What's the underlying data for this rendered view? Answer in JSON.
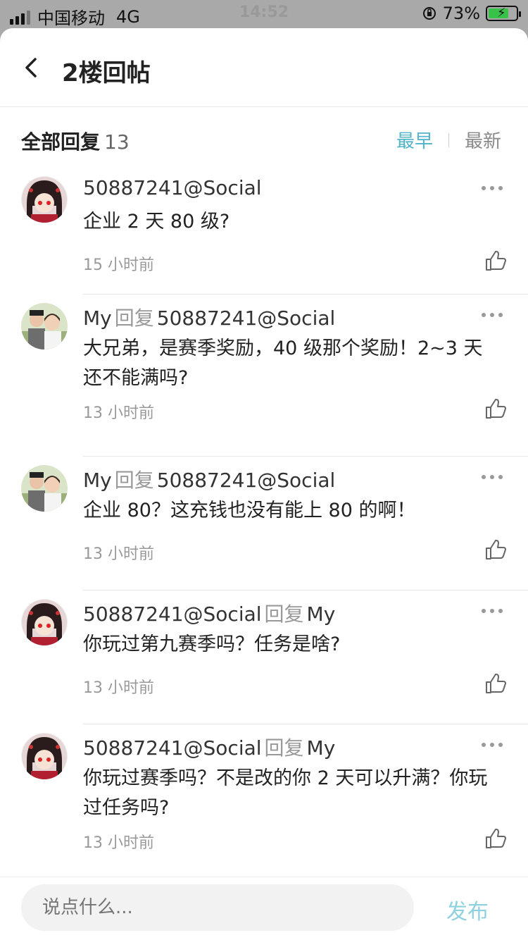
{
  "status_bar": {
    "carrier": "中国移动",
    "network": "4G",
    "time": "14:52",
    "battery": "73%",
    "battery_level": 0.73
  },
  "nav": {
    "title": "2楼回帖"
  },
  "subheader": {
    "label": "全部回复",
    "count": "13",
    "sort_earliest": "最早",
    "sort_latest": "最新"
  },
  "replies": [
    {
      "user": "50887241@Social",
      "verb": "",
      "target": "",
      "content": "企业 2 天 80 级?",
      "time": "15 小时前",
      "avatar": "anime-girl-avatar"
    },
    {
      "user": "My",
      "verb": "回复",
      "target": "50887241@Social",
      "content": "大兄弟，是赛季奖励，40 级那个奖励！2~3 天还不能满吗?",
      "time": "13 小时前",
      "avatar": "couple-photo-avatar"
    },
    {
      "user": "My",
      "verb": "回复",
      "target": "50887241@Social",
      "content": "企业 80？这充钱也没有能上 80 的啊！",
      "time": "13 小时前",
      "avatar": "couple-photo-avatar"
    },
    {
      "user": "50887241@Social",
      "verb": "回复",
      "target": "My",
      "content": "你玩过第九赛季吗？任务是啥?",
      "time": "13 小时前",
      "avatar": "anime-girl-avatar"
    },
    {
      "user": "50887241@Social",
      "verb": "回复",
      "target": "My",
      "content": "你玩过赛季吗？不是改的你 2 天可以升满？你玩过任务吗?",
      "time": "13 小时前",
      "avatar": "anime-girl-avatar"
    }
  ],
  "composer": {
    "placeholder": "说点什么...",
    "send_label": "发布"
  },
  "colors": {
    "accent": "#4fb3c9",
    "send_disabled": "#8fd1de"
  }
}
